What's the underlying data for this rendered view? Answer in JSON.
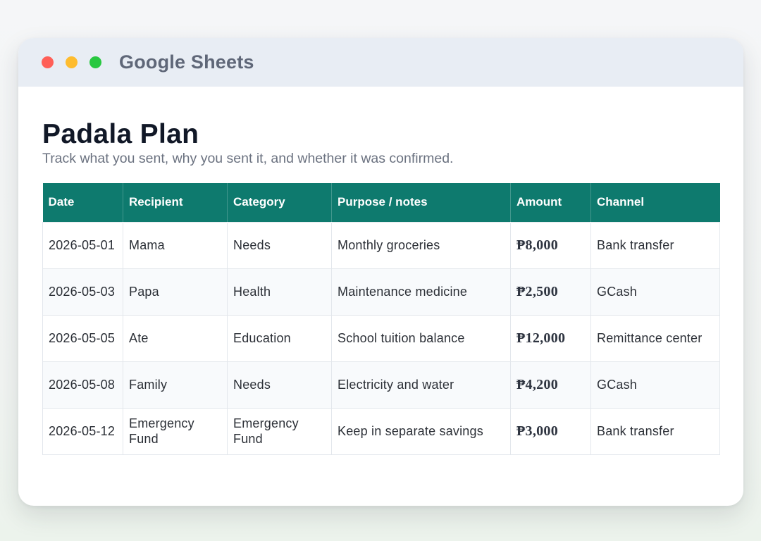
{
  "window": {
    "app_title": "Google Sheets",
    "controls": [
      {
        "name": "close",
        "color": "#ff5f57"
      },
      {
        "name": "minimize",
        "color": "#febc2e"
      },
      {
        "name": "maximize",
        "color": "#28c840"
      }
    ]
  },
  "page": {
    "title": "Padala Plan",
    "subtitle": "Track what you sent, why you sent it, and whether it was confirmed."
  },
  "colors": {
    "header_bg": "#0e7a6e",
    "header_text": "#ffffff"
  },
  "table": {
    "columns": [
      "Date",
      "Recipient",
      "Category",
      "Purpose / notes",
      "Amount",
      "Channel"
    ],
    "rows": [
      {
        "date": "2026-05-01",
        "recipient": "Mama",
        "category": "Needs",
        "purpose": "Monthly groceries",
        "amount": "₱8,000",
        "channel": "Bank transfer"
      },
      {
        "date": "2026-05-03",
        "recipient": "Papa",
        "category": "Health",
        "purpose": "Maintenance medicine",
        "amount": "₱2,500",
        "channel": "GCash"
      },
      {
        "date": "2026-05-05",
        "recipient": "Ate",
        "category": "Education",
        "purpose": "School tuition balance",
        "amount": "₱12,000",
        "channel": "Remittance center"
      },
      {
        "date": "2026-05-08",
        "recipient": "Family",
        "category": "Needs",
        "purpose": "Electricity and water",
        "amount": "₱4,200",
        "channel": "GCash"
      },
      {
        "date": "2026-05-12",
        "recipient": "Emergency Fund",
        "category": "Emergency Fund",
        "purpose": "Keep in separate savings",
        "amount": "₱3,000",
        "channel": "Bank transfer"
      }
    ]
  }
}
